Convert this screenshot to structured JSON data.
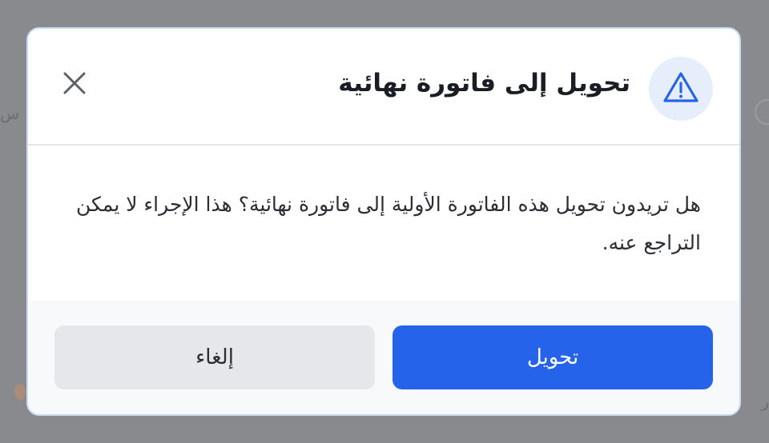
{
  "dialog": {
    "title": "تحويل إلى فاتورة نهائية",
    "icon": "warning-triangle-icon",
    "close_icon": "close-icon",
    "message": "هل تريدون تحويل هذه الفاتورة الأولية إلى فاتورة نهائية؟ هذا الإجراء لا يمكن التراجع عنه.",
    "confirm_label": "تحويل",
    "cancel_label": "إلغاء"
  },
  "colors": {
    "primary": "#2563eb",
    "warning_icon": "#2563eb",
    "badge_bg": "#e6eefb",
    "backdrop": "#888a8d"
  }
}
